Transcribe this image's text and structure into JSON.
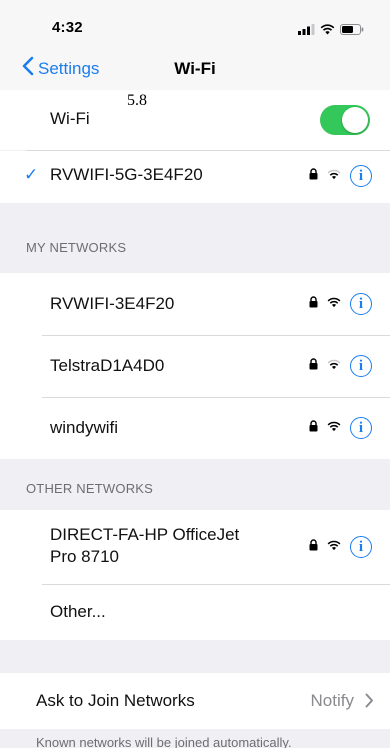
{
  "status_bar": {
    "time": "4:32",
    "icons": [
      "cellular-signal-icon",
      "wifi-icon",
      "battery-icon"
    ]
  },
  "nav": {
    "back_label": "Settings",
    "title": "Wi-Fi"
  },
  "overlay_value": "5.8",
  "wifi_toggle": {
    "label": "Wi-Fi",
    "state": "on"
  },
  "connected_network": {
    "name": "RVWIFI-5G-3E4F20",
    "icons": [
      "checkmark-icon",
      "lock-icon",
      "wifi-icon",
      "info-icon"
    ]
  },
  "my_networks": {
    "header": "MY NETWORKS",
    "items": [
      {
        "name": "RVWIFI-3E4F20"
      },
      {
        "name": "TelstraD1A4D0"
      },
      {
        "name": "windywifi"
      }
    ]
  },
  "other_networks": {
    "header": "OTHER NETWORKS",
    "items": [
      {
        "name_line1": "DIRECT-FA-HP OfficeJet",
        "name_line2": "Pro 8710"
      }
    ],
    "other_label": "Other..."
  },
  "ask_to_join": {
    "label": "Ask to Join Networks",
    "value": "Notify"
  },
  "footer": {
    "text": "Known networks will be joined automatically."
  },
  "colors": {
    "accent": "#1a7df0",
    "toggle_on": "#34c759",
    "grouped_background": "#efeff4"
  }
}
